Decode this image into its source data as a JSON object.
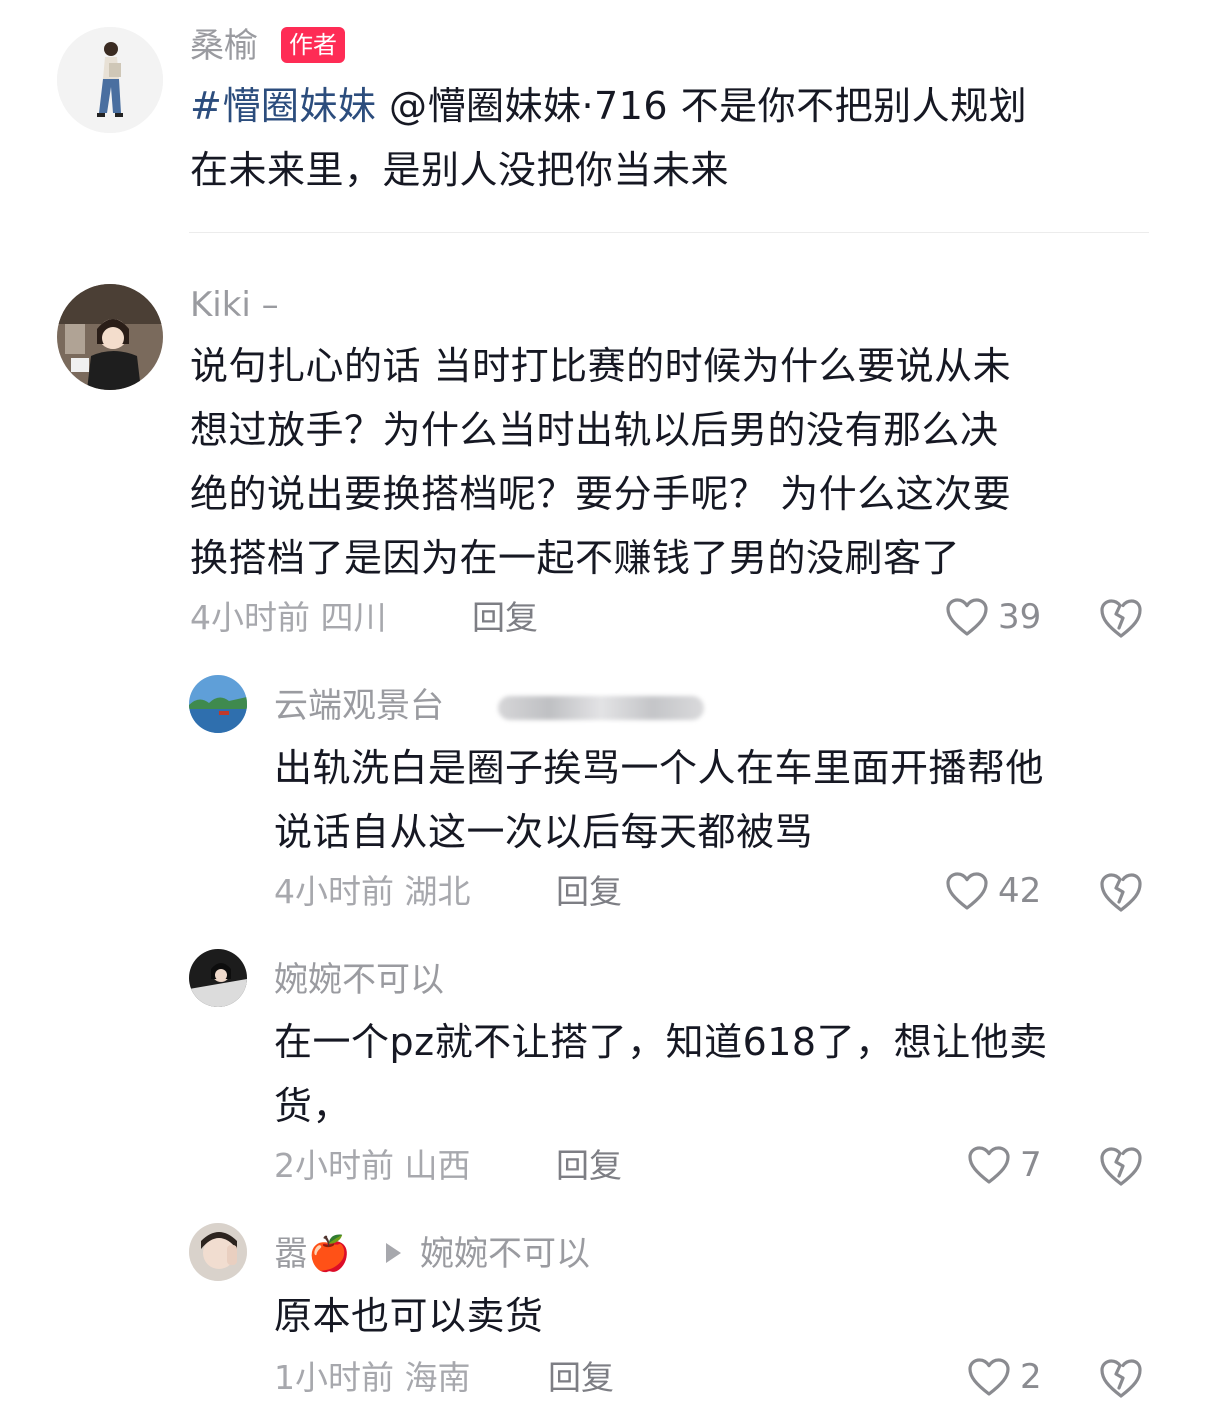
{
  "author_post": {
    "name": "桑榆",
    "tag": "作者",
    "hashtag": "#懵圈妹妹",
    "mention": "@懵圈妹妹·716",
    "text_line1": " 不是你不把别人规划",
    "text_line2": "在未来里，是别人没把你当未来"
  },
  "comments": [
    {
      "name": "Kiki –",
      "lines": [
        "说句扎心的话 当时打比赛的时候为什么要说从未",
        "想过放手？为什么当时出轨以后男的没有那么决",
        "绝的说出要换搭档呢？要分手呢？ 为什么这次要",
        "换搭档了是因为在一起不赚钱了男的没刷客了"
      ],
      "time": "4小时前",
      "location": "四川",
      "reply_label": "回复",
      "likes": "39"
    },
    {
      "name": "云端观景台",
      "lines": [
        "出轨洗白是圈子挨骂一个人在车里面开播帮他",
        "说话自从这一次以后每天都被骂"
      ],
      "time": "4小时前",
      "location": "湖北",
      "reply_label": "回复",
      "likes": "42"
    },
    {
      "name": "婉婉不可以",
      "lines": [
        "在一个pz就不让搭了，知道618了，想让他卖",
        "货，"
      ],
      "time": "2小时前",
      "location": "山西",
      "reply_label": "回复",
      "likes": "7"
    },
    {
      "name": "嚣🍎",
      "reply_to": "婉婉不可以",
      "lines": [
        "原本也可以卖货"
      ],
      "time": "1小时前",
      "location": "海南",
      "reply_label": "回复",
      "likes": "2"
    }
  ],
  "icons": {
    "like": "heart-outline-icon",
    "dislike": "broken-heart-icon",
    "reply_arrow": "triangle-right-icon"
  }
}
